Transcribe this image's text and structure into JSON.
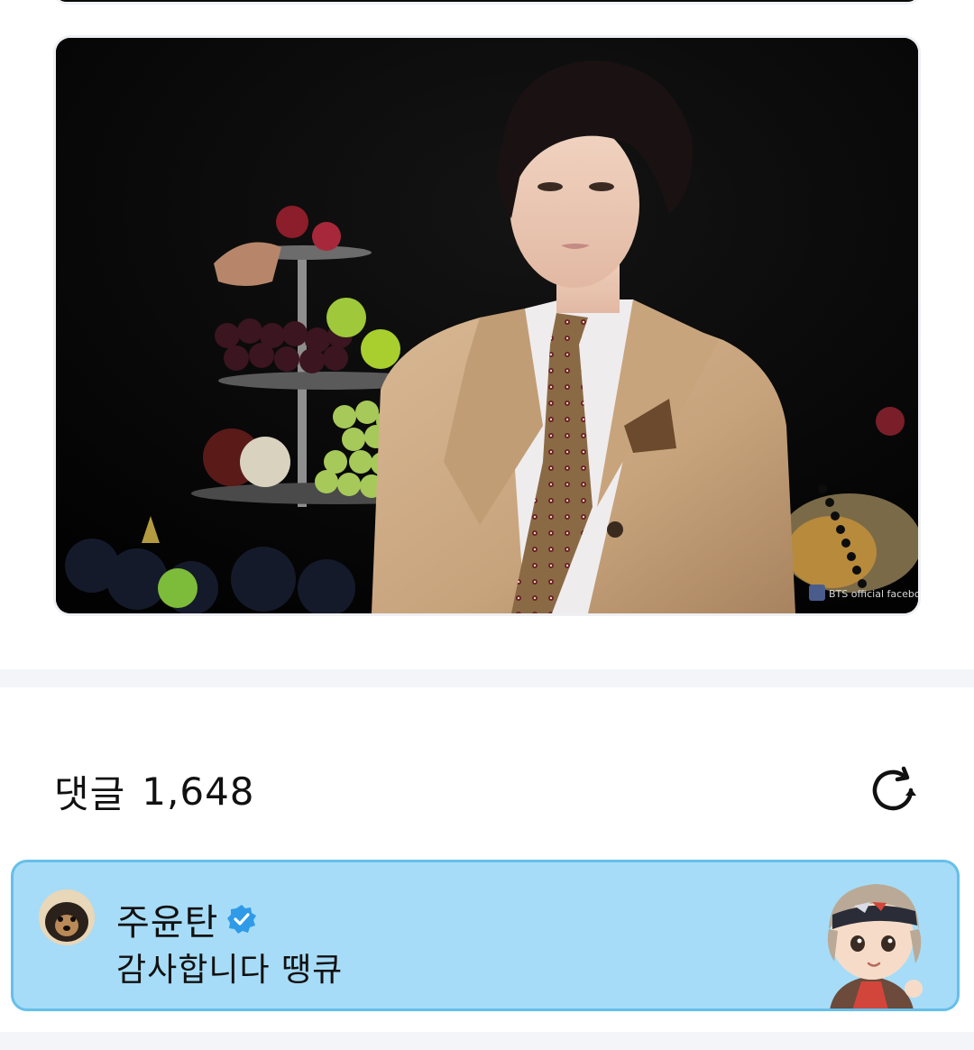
{
  "photo": {
    "alt": "Photo of a man in a beige suit in front of fruit",
    "watermark": "BTS official facebook"
  },
  "comments": {
    "title": "댓글",
    "count": "1,648",
    "refresh_icon": "refresh-icon"
  },
  "highlighted_comment": {
    "author": "주윤탄",
    "verified_icon": "verified-badge-icon",
    "text": "감사합니다 땡큐",
    "background": "#a6dcf7",
    "border": "#66bfe9"
  }
}
